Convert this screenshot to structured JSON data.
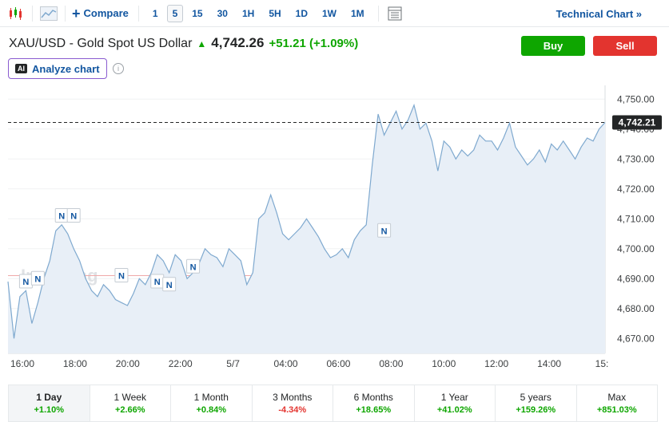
{
  "toolbar": {
    "compare_label": "Compare",
    "intervals": [
      "1",
      "5",
      "15",
      "30",
      "1H",
      "5H",
      "1D",
      "1W",
      "1M"
    ],
    "active_interval": "5",
    "technical_chart_label": "Technical Chart »"
  },
  "instrument": {
    "name": "XAU/USD - Gold Spot US Dollar",
    "price": "4,742.26",
    "change": "+51.21 (+1.09%)"
  },
  "actions": {
    "buy_label": "Buy",
    "sell_label": "Sell",
    "analyze_label": "Analyze chart",
    "ai_badge": "AI"
  },
  "colors": {
    "up": "#0ea600",
    "down": "#e3342f",
    "line": "#7fa9cf",
    "fill": "#e8eff7",
    "link": "#1256a0"
  },
  "chart_data": {
    "type": "area",
    "watermark": "Investing",
    "x_tick_labels": [
      "16:00",
      "18:00",
      "20:00",
      "22:00",
      "5/7",
      "04:00",
      "06:00",
      "08:00",
      "10:00",
      "12:00",
      "14:00",
      "15:"
    ],
    "y_ticks": [
      4670,
      4680,
      4690,
      4700,
      4710,
      4720,
      4730,
      4740,
      4750
    ],
    "y_tick_labels": [
      "4,670.00",
      "4,680.00",
      "4,690.00",
      "4,700.00",
      "4,710.00",
      "4,720.00",
      "4,730.00",
      "4,740.00",
      "4,750.00"
    ],
    "ylim": [
      4665,
      4753
    ],
    "current_price": 4742.21,
    "current_price_label": "4,742.21",
    "reference_level": 4691,
    "x": [
      0,
      1,
      2,
      3,
      4,
      5,
      6,
      7,
      8,
      9,
      10,
      11,
      12,
      13,
      14,
      15,
      16,
      17,
      18,
      19,
      20,
      21,
      22,
      23,
      24,
      25,
      26,
      27,
      28,
      29,
      30,
      31,
      32,
      33,
      34,
      35,
      36,
      37,
      38,
      39,
      40,
      41,
      42,
      43,
      44,
      45,
      46,
      47,
      48,
      49,
      50,
      51,
      52,
      53,
      54,
      55,
      56,
      57,
      58,
      59,
      60,
      61,
      62,
      63,
      64,
      65,
      66,
      67,
      68,
      69,
      70,
      71,
      72,
      73,
      74,
      75,
      76,
      77,
      78,
      79,
      80,
      81,
      82,
      83,
      84,
      85,
      86,
      87,
      88,
      89,
      90,
      91,
      92,
      93,
      94,
      95,
      96,
      97,
      98,
      99,
      100
    ],
    "values": [
      4689,
      4670,
      4684,
      4686,
      4675,
      4682,
      4690,
      4696,
      4706,
      4708,
      4705,
      4700,
      4696,
      4690,
      4686,
      4684,
      4688,
      4686,
      4683,
      4682,
      4681,
      4685,
      4690,
      4688,
      4692,
      4698,
      4696,
      4692,
      4698,
      4696,
      4690,
      4692,
      4695,
      4700,
      4698,
      4697,
      4694,
      4700,
      4698,
      4696,
      4688,
      4692,
      4710,
      4712,
      4718,
      4712,
      4705,
      4703,
      4705,
      4707,
      4710,
      4707,
      4704,
      4700,
      4697,
      4698,
      4700,
      4697,
      4703,
      4706,
      4708,
      4728,
      4745,
      4738,
      4742,
      4746,
      4740,
      4743,
      4748,
      4740,
      4742,
      4736,
      4726,
      4736,
      4734,
      4730,
      4733,
      4731,
      4733,
      4738,
      4736,
      4736,
      4733,
      4737,
      4742,
      4734,
      4731,
      4728,
      4730,
      4733,
      4729,
      4735,
      4733,
      4736,
      4733,
      4730,
      4734,
      4737,
      4736,
      4740,
      4742.21
    ],
    "news_markers": [
      {
        "x": 3,
        "value": 4689,
        "label": "N"
      },
      {
        "x": 5,
        "value": 4690,
        "label": "N"
      },
      {
        "x": 9,
        "value": 4711,
        "label": "N"
      },
      {
        "x": 11,
        "value": 4711,
        "label": "N"
      },
      {
        "x": 19,
        "value": 4691,
        "label": "N"
      },
      {
        "x": 25,
        "value": 4689,
        "label": "N"
      },
      {
        "x": 27,
        "value": 4688,
        "label": "N"
      },
      {
        "x": 31,
        "value": 4694,
        "label": "N"
      },
      {
        "x": 63,
        "value": 4706,
        "label": "N"
      }
    ]
  },
  "periods": [
    {
      "label": "1 Day",
      "change": "+1.10%",
      "dir": "pos"
    },
    {
      "label": "1 Week",
      "change": "+2.66%",
      "dir": "pos"
    },
    {
      "label": "1 Month",
      "change": "+0.84%",
      "dir": "pos"
    },
    {
      "label": "3 Months",
      "change": "-4.34%",
      "dir": "neg"
    },
    {
      "label": "6 Months",
      "change": "+18.65%",
      "dir": "pos"
    },
    {
      "label": "1 Year",
      "change": "+41.02%",
      "dir": "pos"
    },
    {
      "label": "5 years",
      "change": "+159.26%",
      "dir": "pos"
    },
    {
      "label": "Max",
      "change": "+851.03%",
      "dir": "pos"
    }
  ]
}
